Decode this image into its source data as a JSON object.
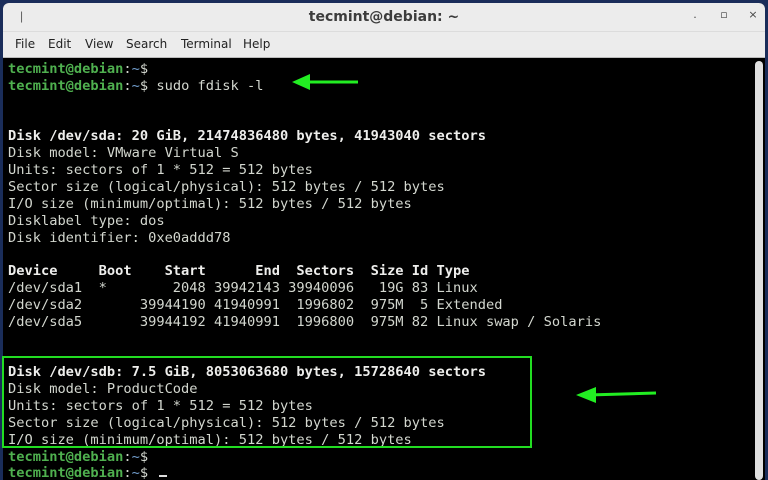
{
  "window": {
    "title": "tecmint@debian: ~",
    "buttons": [
      "minimize",
      "maximize",
      "close"
    ]
  },
  "menu": [
    "File",
    "Edit",
    "View",
    "Search",
    "Terminal",
    "Help"
  ],
  "colors": {
    "prompt": "#4fb04f",
    "path": "#729fcf",
    "highlight": "#22dd22"
  },
  "terminal": {
    "lines": [
      [
        [
          "p",
          "tecmint@debian"
        ],
        [
          "n",
          ":"
        ],
        [
          "t",
          "~"
        ],
        [
          "n",
          "$"
        ]
      ],
      [
        [
          "p",
          "tecmint@debian"
        ],
        [
          "n",
          ":"
        ],
        [
          "t",
          "~"
        ],
        [
          "n",
          "$ sudo fdisk -l"
        ]
      ],
      [],
      [],
      [
        [
          "b",
          "Disk /dev/sda: 20 GiB, 21474836480 bytes, 41943040 sectors"
        ]
      ],
      [
        [
          "n",
          "Disk model: VMware Virtual S"
        ]
      ],
      [
        [
          "n",
          "Units: sectors of 1 * 512 = 512 bytes"
        ]
      ],
      [
        [
          "n",
          "Sector size (logical/physical): 512 bytes / 512 bytes"
        ]
      ],
      [
        [
          "n",
          "I/O size (minimum/optimal): 512 bytes / 512 bytes"
        ]
      ],
      [
        [
          "n",
          "Disklabel type: dos"
        ]
      ],
      [
        [
          "n",
          "Disk identifier: 0xe0addd78"
        ]
      ],
      [],
      [
        [
          "b",
          "Device     Boot    Start      End  Sectors  Size Id Type"
        ]
      ],
      [
        [
          "n",
          "/dev/sda1  *        2048 39942143 39940096   19G 83 Linux"
        ]
      ],
      [
        [
          "n",
          "/dev/sda2       39944190 41940991  1996802  975M  5 Extended"
        ]
      ],
      [
        [
          "n",
          "/dev/sda5       39944192 41940991  1996800  975M 82 Linux swap / Solaris"
        ]
      ],
      [],
      [],
      [
        [
          "b",
          "Disk /dev/sdb: 7.5 GiB, 8053063680 bytes, 15728640 sectors"
        ]
      ],
      [
        [
          "n",
          "Disk model: ProductCode"
        ]
      ],
      [
        [
          "n",
          "Units: sectors of 1 * 512 = 512 bytes"
        ]
      ],
      [
        [
          "n",
          "Sector size (logical/physical): 512 bytes / 512 bytes"
        ]
      ],
      [
        [
          "n",
          "I/O size (minimum/optimal): 512 bytes / 512 bytes"
        ]
      ],
      [
        [
          "p",
          "tecmint@debian"
        ],
        [
          "n",
          ":"
        ],
        [
          "t",
          "~"
        ],
        [
          "n",
          "$"
        ]
      ],
      [
        [
          "p",
          "tecmint@debian"
        ],
        [
          "n",
          ":"
        ],
        [
          "t",
          "~"
        ],
        [
          "n",
          "$"
        ]
      ]
    ]
  }
}
